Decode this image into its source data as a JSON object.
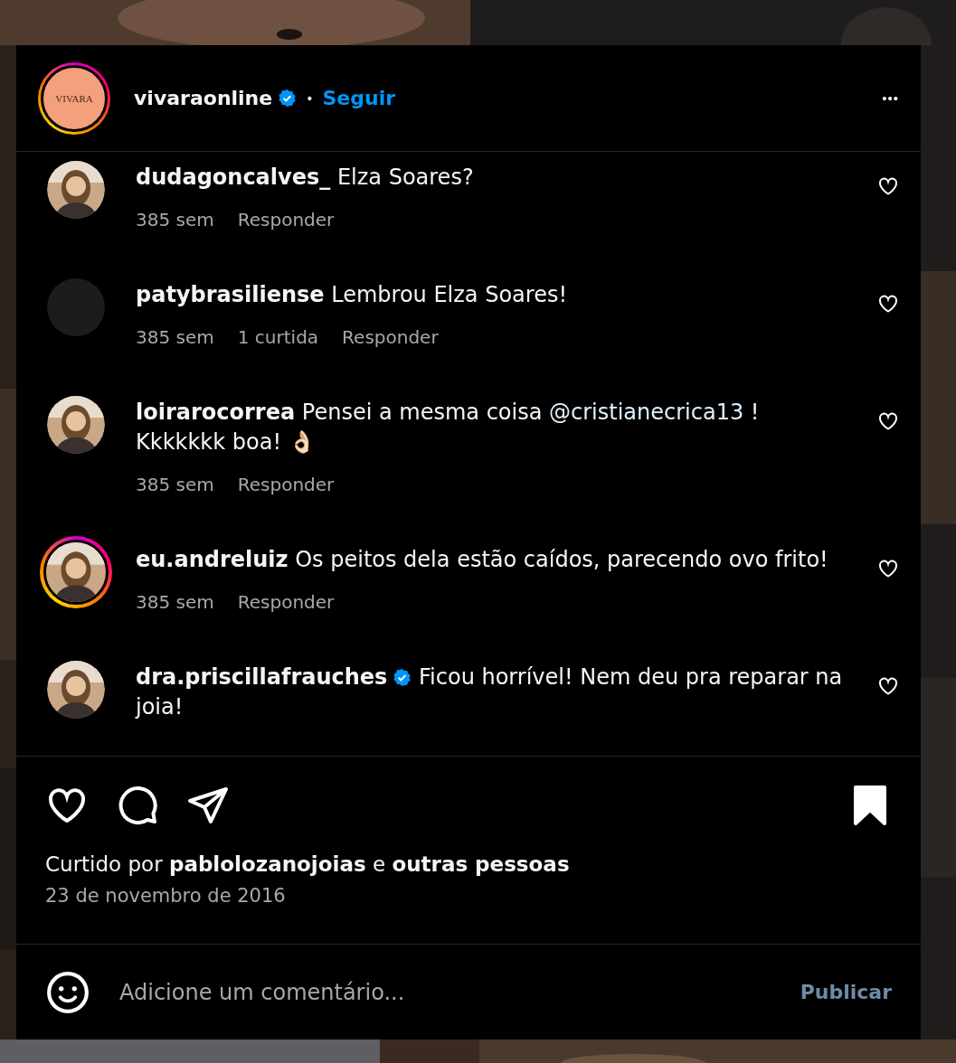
{
  "header": {
    "avatar_text": "VIVARA",
    "story_ring": true,
    "username": "vivaraonline",
    "verified": true,
    "separator": "•",
    "follow": "Seguir",
    "more": "•••"
  },
  "comments": [
    {
      "avatar": {
        "kind": "picture",
        "story_ring": false
      },
      "username": "dudagoncalves_",
      "verified": false,
      "text": [
        {
          "kind": "plain",
          "text": "Elza Soares?"
        }
      ],
      "meta": [
        "385 sem"
      ],
      "reply": "Responder",
      "liked": false
    },
    {
      "avatar": {
        "kind": "blank",
        "story_ring": false
      },
      "username": "patybrasiliense",
      "verified": false,
      "text": [
        {
          "kind": "plain",
          "text": "Lembrou Elza Soares!"
        }
      ],
      "meta": [
        "385 sem",
        "1 curtida"
      ],
      "reply": "Responder",
      "liked": false
    },
    {
      "avatar": {
        "kind": "picture",
        "story_ring": false
      },
      "username": "loirarocorrea",
      "verified": false,
      "text": [
        {
          "kind": "plain",
          "text": "Pensei a mesma coisa "
        },
        {
          "kind": "mention",
          "text": "@cristianecrica13"
        },
        {
          "kind": "plain",
          "text": " ! Kkkkkkk boa! 👌🏻"
        }
      ],
      "meta": [
        "385 sem"
      ],
      "reply": "Responder",
      "liked": false
    },
    {
      "avatar": {
        "kind": "picture",
        "story_ring": true
      },
      "username": "eu.andreluiz",
      "verified": false,
      "text": [
        {
          "kind": "plain",
          "text": "Os peitos dela estão caídos, parecendo ovo frito!"
        }
      ],
      "meta": [
        "385 sem"
      ],
      "reply": "Responder",
      "liked": false
    },
    {
      "avatar": {
        "kind": "picture",
        "story_ring": false
      },
      "username": "dra.priscillafrauches",
      "verified": true,
      "text": [
        {
          "kind": "plain",
          "text": "Ficou horrível! Nem deu pra reparar na joia!"
        }
      ],
      "liked": false
    }
  ],
  "actions": {
    "liked": false,
    "saved": true
  },
  "liked_by": "Curtido por **pablolozanojoias** e **outras pessoas**",
  "date": "23 de novembro de 2016",
  "composer": {
    "placeholder": "Adicione um comentário...",
    "publish": "Publicar"
  }
}
